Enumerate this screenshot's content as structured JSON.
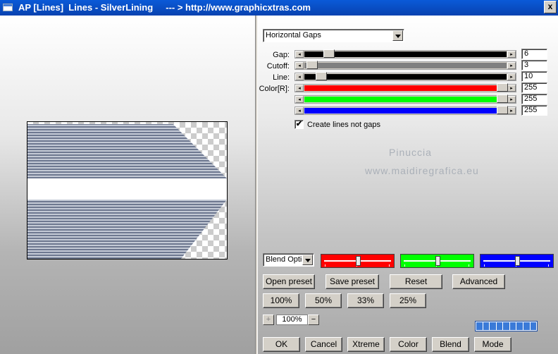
{
  "window": {
    "title": "AP [Lines]  Lines - SilverLining     --- > http://www.graphicxtras.com",
    "close_glyph": "x"
  },
  "method_dropdown": {
    "value": "Horizontal Gaps"
  },
  "parameters": [
    {
      "label": "Gap:",
      "value": "6",
      "track_color": "#000000",
      "level": 0.1
    },
    {
      "label": "Cutoff:",
      "value": "3",
      "track_color": "#808080",
      "level": 0.01
    },
    {
      "label": "Line:",
      "value": "10",
      "track_color": "#000000",
      "level": 0.06
    },
    {
      "label": "Color[R]:",
      "value": "255",
      "track_color": "#ff0000",
      "level": 1.0
    },
    {
      "label": "",
      "value": "255",
      "track_color": "#00ff00",
      "level": 1.0
    },
    {
      "label": "",
      "value": "255",
      "track_color": "#0000ff",
      "level": 1.0
    }
  ],
  "checkbox": {
    "label": "Create lines not gaps",
    "checked": true,
    "mark": "✔"
  },
  "watermark": {
    "line1": "Pinuccia",
    "line2": "www.maidiregrafica.eu"
  },
  "blend_dropdown": {
    "value": "Blend Optio"
  },
  "color_pickers": [
    {
      "color": "#ff0000"
    },
    {
      "color": "#00ff00"
    },
    {
      "color": "#0000ff"
    }
  ],
  "preset_buttons": {
    "open": "Open preset",
    "save": "Save preset",
    "reset": "Reset",
    "advanced": "Advanced"
  },
  "zoom_buttons": [
    "100%",
    "50%",
    "33%",
    "25%"
  ],
  "zoom": {
    "value": "100%",
    "plus": "+",
    "minus": "−"
  },
  "progress": {
    "filled_cells": 9
  },
  "bottom_buttons": {
    "ok": "OK",
    "cancel": "Cancel",
    "xtreme": "Xtreme",
    "color": "Color",
    "blend": "Blend",
    "mode": "Mode"
  }
}
